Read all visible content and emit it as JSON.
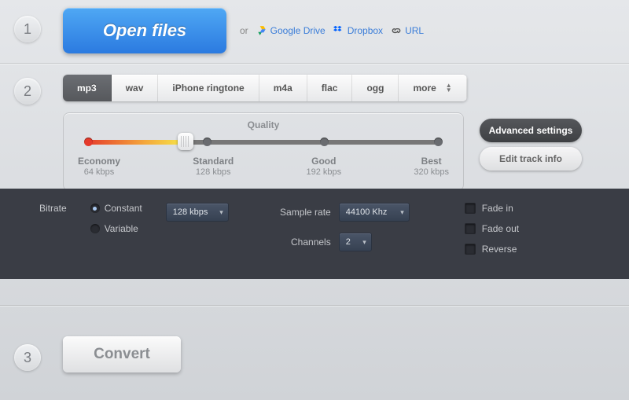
{
  "step1": {
    "num": "1",
    "open_label": "Open files",
    "or": "or",
    "gdrive": "Google Drive",
    "dropbox": "Dropbox",
    "url": "URL"
  },
  "step2": {
    "num": "2",
    "tabs": [
      "mp3",
      "wav",
      "iPhone ringtone",
      "m4a",
      "flac",
      "ogg",
      "more"
    ],
    "quality": {
      "title": "Quality",
      "stops": [
        {
          "name": "Economy",
          "rate": "64 kbps"
        },
        {
          "name": "Standard",
          "rate": "128 kbps"
        },
        {
          "name": "Good",
          "rate": "192 kbps"
        },
        {
          "name": "Best",
          "rate": "320 kbps"
        }
      ]
    },
    "buttons": {
      "adv": "Advanced settings",
      "edit": "Edit track info"
    }
  },
  "adv": {
    "bitrate_label": "Bitrate",
    "constant": "Constant",
    "variable": "Variable",
    "bitrate_val": "128 kbps",
    "samplerate_label": "Sample rate",
    "samplerate_val": "44100 Khz",
    "channels_label": "Channels",
    "channels_val": "2",
    "fadein": "Fade in",
    "fadeout": "Fade out",
    "reverse": "Reverse"
  },
  "step3": {
    "num": "3",
    "convert": "Convert"
  }
}
